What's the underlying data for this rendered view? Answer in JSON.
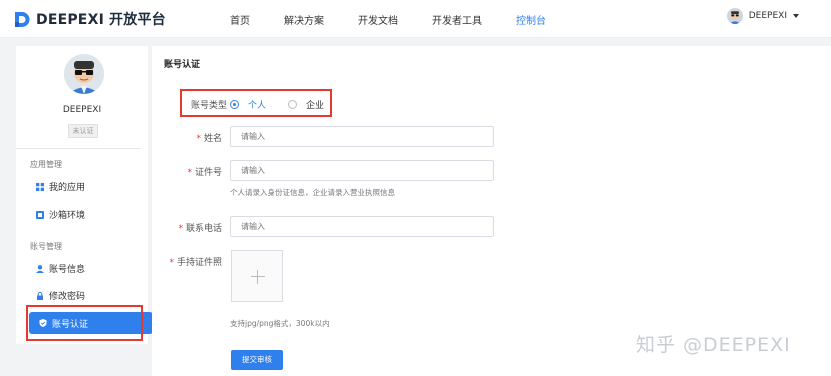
{
  "header": {
    "brand": "DEEPEXI 开放平台",
    "nav": [
      "首页",
      "解决方案",
      "开发文档",
      "开发者工具",
      "控制台"
    ],
    "active_nav": "控制台",
    "username": "DEEPEXI"
  },
  "sidebar": {
    "username": "DEEPEXI",
    "badge": "未认证",
    "groups": [
      {
        "label": "应用管理",
        "items": [
          {
            "label": "我的应用",
            "icon": "grid-icon"
          },
          {
            "label": "沙箱环境",
            "icon": "sandbox-icon"
          }
        ]
      },
      {
        "label": "账号管理",
        "items": [
          {
            "label": "账号信息",
            "icon": "user-icon"
          },
          {
            "label": "修改密码",
            "icon": "lock-icon"
          },
          {
            "label": "账号认证",
            "icon": "shield-icon",
            "active": true
          }
        ]
      }
    ]
  },
  "main": {
    "section_title": "账号认证",
    "account_type": {
      "label": "账号类型",
      "options": [
        "个人",
        "企业"
      ],
      "selected": "个人"
    },
    "name_field": {
      "label": "姓名",
      "placeholder": "请输入"
    },
    "id_field": {
      "label": "证件号",
      "placeholder": "请输入",
      "hint": "个人请录入身份证信息，企业请录入营业执照信息"
    },
    "phone_field": {
      "label": "联系电话",
      "placeholder": "请输入"
    },
    "photo_field": {
      "label": "手持证件照",
      "hint": "支持jpg/png格式，300k以内"
    },
    "submit_label": "提交审核"
  },
  "watermark": "知乎 @DEEPEXI",
  "colors": {
    "primary": "#2f80ed",
    "required": "#e4393c",
    "highlight": "#e53935"
  }
}
